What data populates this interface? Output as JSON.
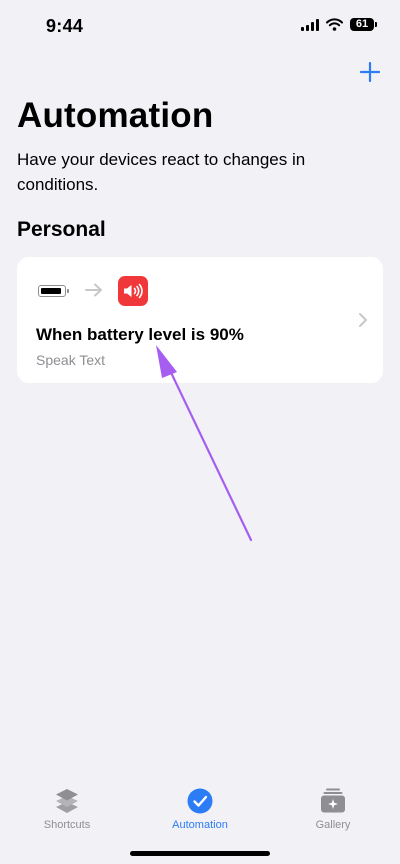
{
  "status_bar": {
    "time": "9:44",
    "battery": "61"
  },
  "header": {
    "title": "Automation",
    "subtitle": "Have your devices react to changes in conditions."
  },
  "section": {
    "title": "Personal"
  },
  "automation": {
    "title": "When battery level is 90%",
    "subtitle": "Speak Text"
  },
  "tabs": [
    {
      "label": "Shortcuts",
      "icon": "layers-icon",
      "active": false
    },
    {
      "label": "Automation",
      "icon": "checkmark-clock-icon",
      "active": true
    },
    {
      "label": "Gallery",
      "icon": "gallery-icon",
      "active": false
    }
  ],
  "colors": {
    "background": "#f2f1f6",
    "accent": "#2c7cf6",
    "speak_text_tile": "#f0383a",
    "annotation_arrow": "#a55ef0"
  }
}
